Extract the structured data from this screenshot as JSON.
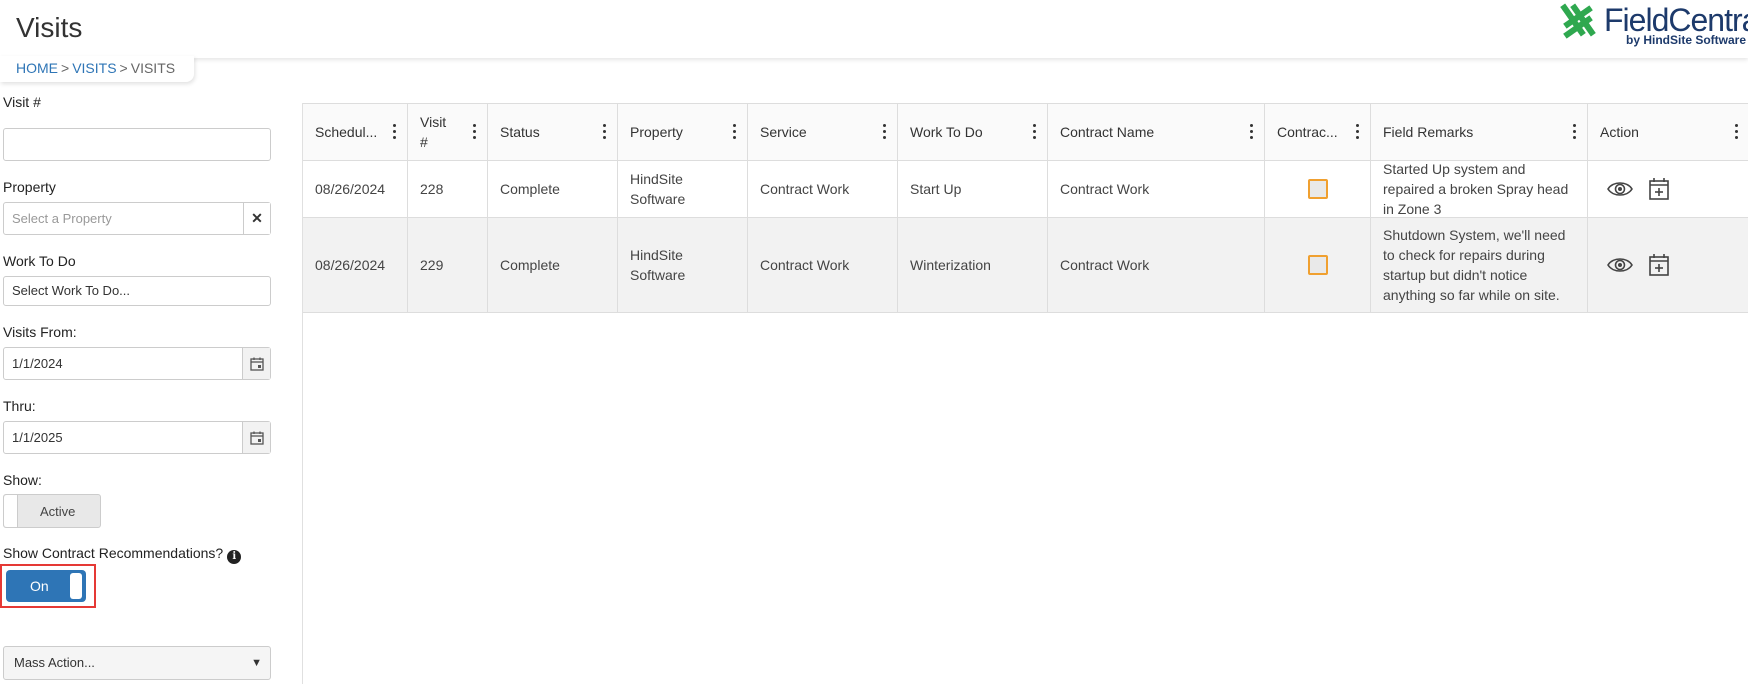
{
  "header": {
    "title": "Visits",
    "logo_text": "FieldCentral",
    "logo_sub": "by HindSite Software"
  },
  "breadcrumb": [
    "HOME",
    "VISITS",
    "VISITS"
  ],
  "filters": {
    "visit_num_label": "Visit #",
    "visit_num_value": "",
    "property_label": "Property",
    "property_placeholder": "Select a Property",
    "work_to_do_label": "Work To Do",
    "work_to_do_value": "Select Work To Do...",
    "visits_from_label": "Visits From:",
    "visits_from_value": "1/1/2024",
    "thru_label": "Thru:",
    "thru_value": "1/1/2025",
    "show_label": "Show:",
    "show_value": "Active",
    "contract_rec_label": "Show Contract Recommendations?",
    "contract_rec_value": "On",
    "mass_action": "Mass Action..."
  },
  "grid": {
    "columns": [
      "Schedul...",
      "Visit #",
      "Status",
      "Property",
      "Service",
      "Work To Do",
      "Contract Name",
      "Contrac...",
      "Field Remarks",
      "Action"
    ],
    "rows": [
      {
        "scheduled": "08/26/2024",
        "visit": "228",
        "status": "Complete",
        "property": "HindSite Software",
        "service": "Contract Work",
        "work_to_do": "Start Up",
        "contract_name": "Contract Work",
        "contract_checked": false,
        "remarks": "Started Up system and repaired a broken Spray head in Zone 3"
      },
      {
        "scheduled": "08/26/2024",
        "visit": "229",
        "status": "Complete",
        "property": "HindSite Software",
        "service": "Contract Work",
        "work_to_do": "Winterization",
        "contract_name": "Contract Work",
        "contract_checked": false,
        "remarks": "Shutdown System, we'll need to check for repairs during startup but didn't notice anything so far while on site."
      }
    ]
  },
  "colors": {
    "accent": "#2e75b6",
    "checkbox_border": "#f0a030",
    "highlight": "#e53935",
    "logo": "#1d3a6b",
    "logo_mark": "#2fa84f"
  },
  "icons": [
    "info-icon",
    "calendar-icon",
    "clear-icon",
    "view-icon",
    "add-schedule-icon",
    "column-menu-icon",
    "dropdown-caret-icon"
  ]
}
